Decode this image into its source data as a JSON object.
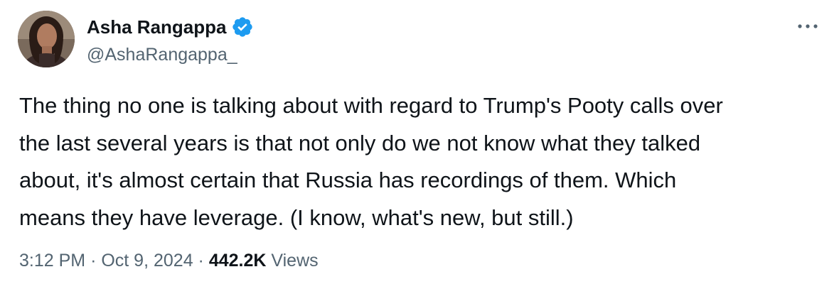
{
  "author": {
    "display_name": "Asha Rangappa",
    "handle": "@AshaRangappa_",
    "verified": true,
    "verified_color": "#1d9bf0"
  },
  "tweet": {
    "text": "The thing no one is talking about with regard to Trump's Pooty calls over\nthe last several years is that not only do we not know what they talked\nabout, it's almost certain that Russia has recordings of them. Which\nmeans they have leverage. (I know, what's new, but still.)",
    "time": "3:12 PM",
    "separator": "·",
    "date": "Oct 9, 2024",
    "views_count": "442.2K",
    "views_label": "Views"
  },
  "icons": {
    "more": "more-horizontal-icon",
    "verified": "verified-badge-icon"
  },
  "colors": {
    "text_primary": "#0f1419",
    "text_secondary": "#536471",
    "background": "#ffffff"
  }
}
